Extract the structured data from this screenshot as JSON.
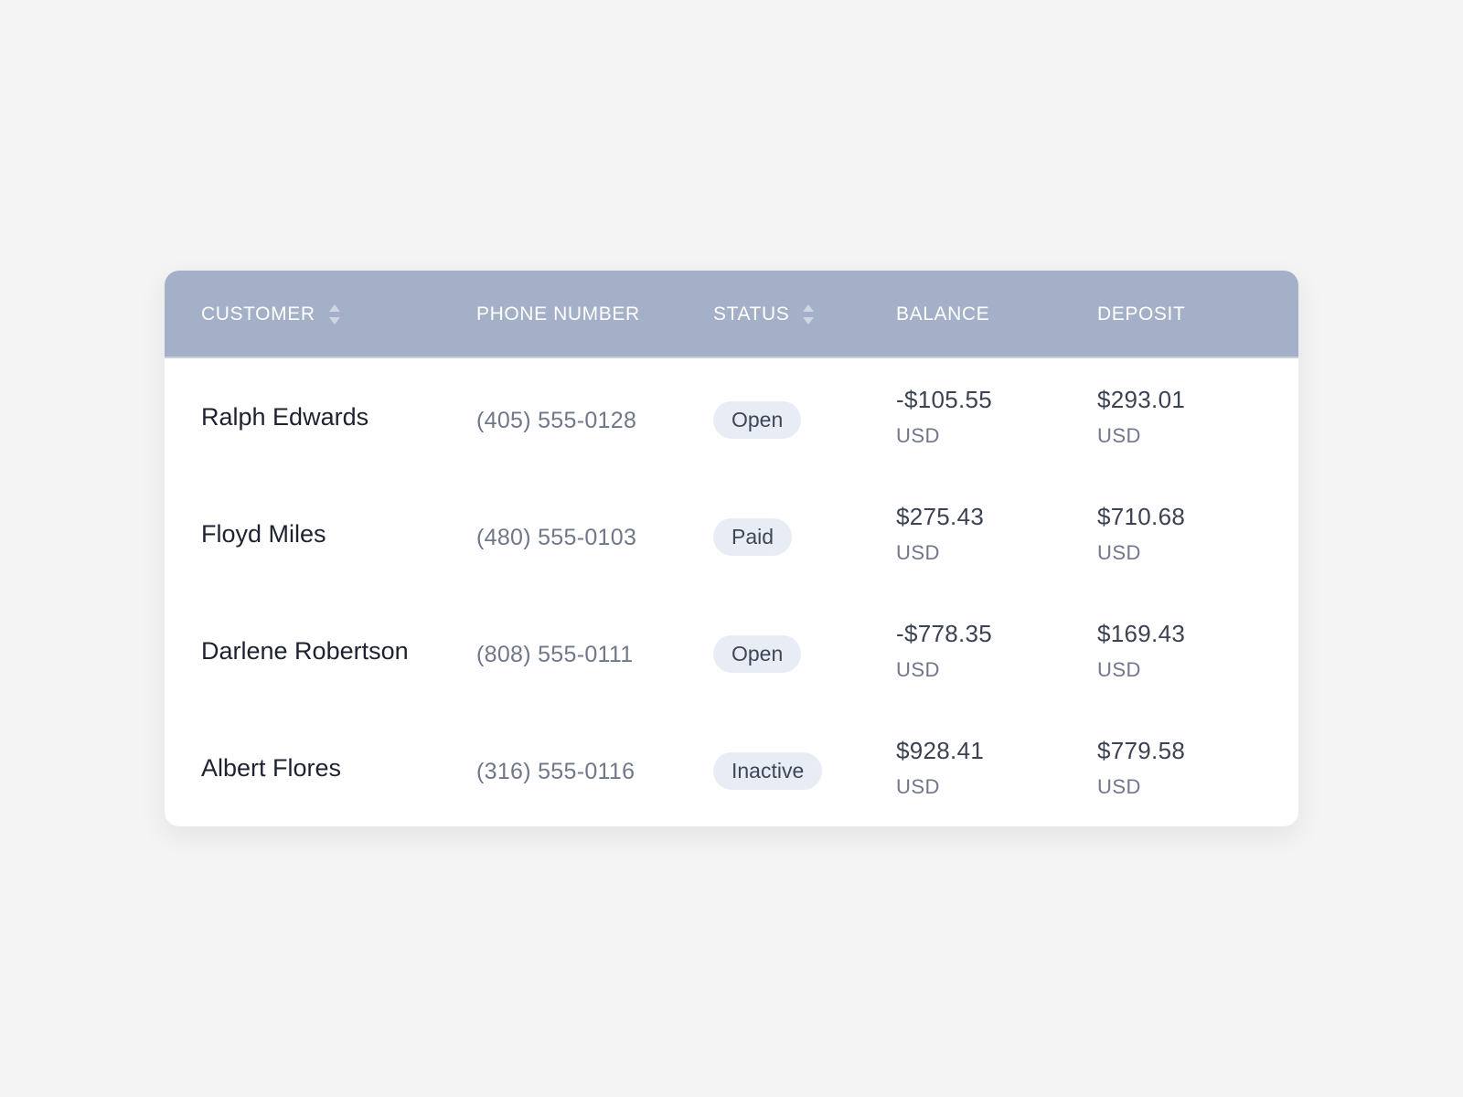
{
  "table": {
    "headers": {
      "customer": "CUSTOMER",
      "phone": "PHONE NUMBER",
      "status": "STATUS",
      "balance": "BALANCE",
      "deposit": "DEPOSIT"
    },
    "sortable_columns": [
      "customer",
      "status"
    ],
    "rows": [
      {
        "customer": "Ralph Edwards",
        "phone": "(405) 555-0128",
        "status": "Open",
        "balance": "-$105.55",
        "balance_currency": "USD",
        "deposit": "$293.01",
        "deposit_currency": "USD"
      },
      {
        "customer": "Floyd Miles",
        "phone": "(480) 555-0103",
        "status": "Paid",
        "balance": "$275.43",
        "balance_currency": "USD",
        "deposit": "$710.68",
        "deposit_currency": "USD"
      },
      {
        "customer": "Darlene Robertson",
        "phone": "(808) 555-0111",
        "status": "Open",
        "balance": "-$778.35",
        "balance_currency": "USD",
        "deposit": "$169.43",
        "deposit_currency": "USD"
      },
      {
        "customer": "Albert Flores",
        "phone": "(316) 555-0116",
        "status": "Inactive",
        "balance": "$928.41",
        "balance_currency": "USD",
        "deposit": "$779.58",
        "deposit_currency": "USD"
      }
    ]
  },
  "colors": {
    "page_background": "#f4f4f4",
    "header_background": "#a4b0c8",
    "header_text": "#ffffff",
    "badge_background": "#e8ecf4",
    "name_text": "#1c2230",
    "secondary_text": "#6f7789"
  },
  "icons": {
    "sort": "sort-icon"
  }
}
